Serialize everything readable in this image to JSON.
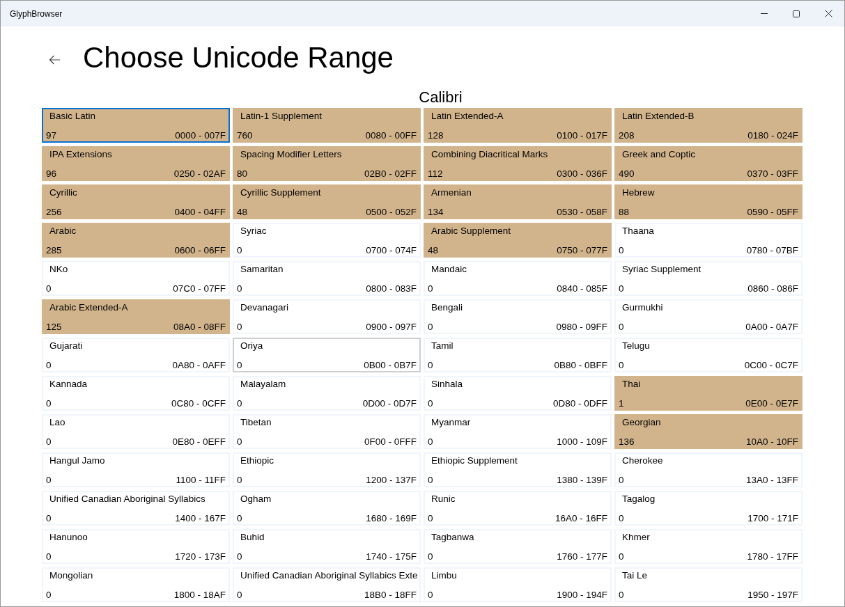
{
  "window": {
    "title": "GlyphBrowser"
  },
  "page": {
    "title": "Choose Unicode Range",
    "font_name": "Calibri"
  },
  "ranges": [
    {
      "name": "Basic Latin",
      "count": "97",
      "range": "0000 - 007F",
      "has_glyphs": true,
      "selected": true,
      "hovered": false
    },
    {
      "name": "Latin-1 Supplement",
      "count": "760",
      "range": "0080 - 00FF",
      "has_glyphs": true,
      "selected": false,
      "hovered": false
    },
    {
      "name": "Latin Extended-A",
      "count": "128",
      "range": "0100 - 017F",
      "has_glyphs": true,
      "selected": false,
      "hovered": false
    },
    {
      "name": "Latin Extended-B",
      "count": "208",
      "range": "0180 - 024F",
      "has_glyphs": true,
      "selected": false,
      "hovered": false
    },
    {
      "name": "IPA Extensions",
      "count": "96",
      "range": "0250 - 02AF",
      "has_glyphs": true,
      "selected": false,
      "hovered": false
    },
    {
      "name": "Spacing Modifier Letters",
      "count": "80",
      "range": "02B0 - 02FF",
      "has_glyphs": true,
      "selected": false,
      "hovered": false
    },
    {
      "name": "Combining Diacritical Marks",
      "count": "112",
      "range": "0300 - 036F",
      "has_glyphs": true,
      "selected": false,
      "hovered": false
    },
    {
      "name": "Greek and Coptic",
      "count": "490",
      "range": "0370 - 03FF",
      "has_glyphs": true,
      "selected": false,
      "hovered": false
    },
    {
      "name": "Cyrillic",
      "count": "256",
      "range": "0400 - 04FF",
      "has_glyphs": true,
      "selected": false,
      "hovered": false
    },
    {
      "name": "Cyrillic Supplement",
      "count": "48",
      "range": "0500 - 052F",
      "has_glyphs": true,
      "selected": false,
      "hovered": false
    },
    {
      "name": "Armenian",
      "count": "134",
      "range": "0530 - 058F",
      "has_glyphs": true,
      "selected": false,
      "hovered": false
    },
    {
      "name": "Hebrew",
      "count": "88",
      "range": "0590 - 05FF",
      "has_glyphs": true,
      "selected": false,
      "hovered": false
    },
    {
      "name": "Arabic",
      "count": "285",
      "range": "0600 - 06FF",
      "has_glyphs": true,
      "selected": false,
      "hovered": false
    },
    {
      "name": "Syriac",
      "count": "0",
      "range": "0700 - 074F",
      "has_glyphs": false,
      "selected": false,
      "hovered": false
    },
    {
      "name": "Arabic Supplement",
      "count": "48",
      "range": "0750 - 077F",
      "has_glyphs": true,
      "selected": false,
      "hovered": false
    },
    {
      "name": "Thaana",
      "count": "0",
      "range": "0780 - 07BF",
      "has_glyphs": false,
      "selected": false,
      "hovered": false
    },
    {
      "name": "NKo",
      "count": "0",
      "range": "07C0 - 07FF",
      "has_glyphs": false,
      "selected": false,
      "hovered": false
    },
    {
      "name": "Samaritan",
      "count": "0",
      "range": "0800 - 083F",
      "has_glyphs": false,
      "selected": false,
      "hovered": false
    },
    {
      "name": "Mandaic",
      "count": "0",
      "range": "0840 - 085F",
      "has_glyphs": false,
      "selected": false,
      "hovered": false
    },
    {
      "name": "Syriac Supplement",
      "count": "0",
      "range": "0860 - 086F",
      "has_glyphs": false,
      "selected": false,
      "hovered": false
    },
    {
      "name": "Arabic Extended-A",
      "count": "125",
      "range": "08A0 - 08FF",
      "has_glyphs": true,
      "selected": false,
      "hovered": false
    },
    {
      "name": "Devanagari",
      "count": "0",
      "range": "0900 - 097F",
      "has_glyphs": false,
      "selected": false,
      "hovered": false
    },
    {
      "name": "Bengali",
      "count": "0",
      "range": "0980 - 09FF",
      "has_glyphs": false,
      "selected": false,
      "hovered": false
    },
    {
      "name": "Gurmukhi",
      "count": "0",
      "range": "0A00 - 0A7F",
      "has_glyphs": false,
      "selected": false,
      "hovered": false
    },
    {
      "name": "Gujarati",
      "count": "0",
      "range": "0A80 - 0AFF",
      "has_glyphs": false,
      "selected": false,
      "hovered": false
    },
    {
      "name": "Oriya",
      "count": "0",
      "range": "0B00 - 0B7F",
      "has_glyphs": false,
      "selected": false,
      "hovered": true
    },
    {
      "name": "Tamil",
      "count": "0",
      "range": "0B80 - 0BFF",
      "has_glyphs": false,
      "selected": false,
      "hovered": false
    },
    {
      "name": "Telugu",
      "count": "0",
      "range": "0C00 - 0C7F",
      "has_glyphs": false,
      "selected": false,
      "hovered": false
    },
    {
      "name": "Kannada",
      "count": "0",
      "range": "0C80 - 0CFF",
      "has_glyphs": false,
      "selected": false,
      "hovered": false
    },
    {
      "name": "Malayalam",
      "count": "0",
      "range": "0D00 - 0D7F",
      "has_glyphs": false,
      "selected": false,
      "hovered": false
    },
    {
      "name": "Sinhala",
      "count": "0",
      "range": "0D80 - 0DFF",
      "has_glyphs": false,
      "selected": false,
      "hovered": false
    },
    {
      "name": "Thai",
      "count": "1",
      "range": "0E00 - 0E7F",
      "has_glyphs": true,
      "selected": false,
      "hovered": false
    },
    {
      "name": "Lao",
      "count": "0",
      "range": "0E80 - 0EFF",
      "has_glyphs": false,
      "selected": false,
      "hovered": false
    },
    {
      "name": "Tibetan",
      "count": "0",
      "range": "0F00 - 0FFF",
      "has_glyphs": false,
      "selected": false,
      "hovered": false
    },
    {
      "name": "Myanmar",
      "count": "0",
      "range": "1000 - 109F",
      "has_glyphs": false,
      "selected": false,
      "hovered": false
    },
    {
      "name": "Georgian",
      "count": "136",
      "range": "10A0 - 10FF",
      "has_glyphs": true,
      "selected": false,
      "hovered": false
    },
    {
      "name": "Hangul Jamo",
      "count": "0",
      "range": "1100 - 11FF",
      "has_glyphs": false,
      "selected": false,
      "hovered": false
    },
    {
      "name": "Ethiopic",
      "count": "0",
      "range": "1200 - 137F",
      "has_glyphs": false,
      "selected": false,
      "hovered": false
    },
    {
      "name": "Ethiopic Supplement",
      "count": "0",
      "range": "1380 - 139F",
      "has_glyphs": false,
      "selected": false,
      "hovered": false
    },
    {
      "name": "Cherokee",
      "count": "0",
      "range": "13A0 - 13FF",
      "has_glyphs": false,
      "selected": false,
      "hovered": false
    },
    {
      "name": "Unified Canadian Aboriginal Syllabics",
      "count": "0",
      "range": "1400 - 167F",
      "has_glyphs": false,
      "selected": false,
      "hovered": false
    },
    {
      "name": "Ogham",
      "count": "0",
      "range": "1680 - 169F",
      "has_glyphs": false,
      "selected": false,
      "hovered": false
    },
    {
      "name": "Runic",
      "count": "0",
      "range": "16A0 - 16FF",
      "has_glyphs": false,
      "selected": false,
      "hovered": false
    },
    {
      "name": "Tagalog",
      "count": "0",
      "range": "1700 - 171F",
      "has_glyphs": false,
      "selected": false,
      "hovered": false
    },
    {
      "name": "Hanunoo",
      "count": "0",
      "range": "1720 - 173F",
      "has_glyphs": false,
      "selected": false,
      "hovered": false
    },
    {
      "name": "Buhid",
      "count": "0",
      "range": "1740 - 175F",
      "has_glyphs": false,
      "selected": false,
      "hovered": false
    },
    {
      "name": "Tagbanwa",
      "count": "0",
      "range": "1760 - 177F",
      "has_glyphs": false,
      "selected": false,
      "hovered": false
    },
    {
      "name": "Khmer",
      "count": "0",
      "range": "1780 - 17FF",
      "has_glyphs": false,
      "selected": false,
      "hovered": false
    },
    {
      "name": "Mongolian",
      "count": "0",
      "range": "1800 - 18AF",
      "has_glyphs": false,
      "selected": false,
      "hovered": false
    },
    {
      "name": "Unified Canadian Aboriginal Syllabics Exte",
      "count": "0",
      "range": "18B0 - 18FF",
      "has_glyphs": false,
      "selected": false,
      "hovered": false
    },
    {
      "name": "Limbu",
      "count": "0",
      "range": "1900 - 194F",
      "has_glyphs": false,
      "selected": false,
      "hovered": false
    },
    {
      "name": "Tai Le",
      "count": "0",
      "range": "1950 - 197F",
      "has_glyphs": false,
      "selected": false,
      "hovered": false
    }
  ]
}
